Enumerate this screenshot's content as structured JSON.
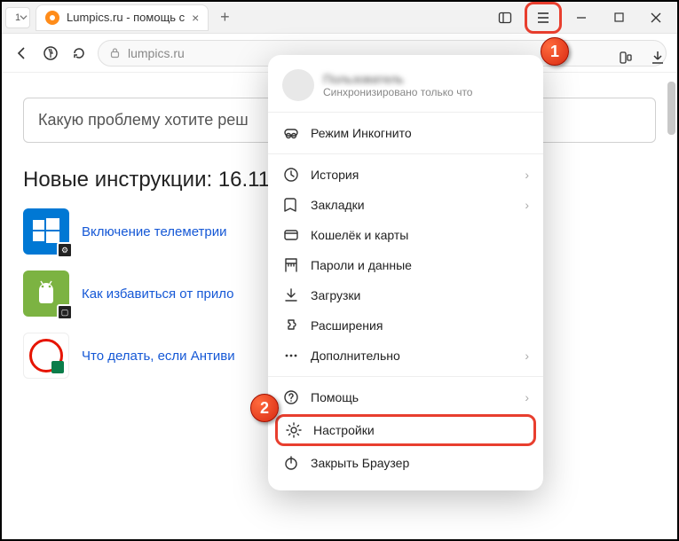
{
  "tab_bar": {
    "counter": "1",
    "tab_title": "Lumpics.ru - помощь с",
    "close": "×",
    "new_tab": "+"
  },
  "address": {
    "url": "lumpics.ru"
  },
  "page": {
    "search_placeholder": "Какую проблему хотите реш",
    "heading": "Новые инструкции: 16.11.",
    "articles": [
      {
        "text": "Включение телеметрии"
      },
      {
        "text": "Как избавиться от прило"
      },
      {
        "text": "Что делать, если Антиви"
      }
    ]
  },
  "menu": {
    "user": "Пользователь",
    "sync": "Синхронизировано только что",
    "items": [
      {
        "icon": "incognito",
        "label": "Режим Инкогнито",
        "arrow": false,
        "hl": false
      },
      {
        "sep": true
      },
      {
        "icon": "history",
        "label": "История",
        "arrow": true,
        "hl": false
      },
      {
        "icon": "bookmark",
        "label": "Закладки",
        "arrow": true,
        "hl": false
      },
      {
        "icon": "wallet",
        "label": "Кошелёк и карты",
        "arrow": false,
        "hl": false
      },
      {
        "icon": "key",
        "label": "Пароли и данные",
        "arrow": false,
        "hl": false
      },
      {
        "icon": "download",
        "label": "Загрузки",
        "arrow": false,
        "hl": false
      },
      {
        "icon": "puzzle",
        "label": "Расширения",
        "arrow": false,
        "hl": false
      },
      {
        "icon": "more",
        "label": "Дополнительно",
        "arrow": true,
        "hl": false
      },
      {
        "sep": true
      },
      {
        "icon": "help",
        "label": "Помощь",
        "arrow": true,
        "hl": false
      },
      {
        "icon": "settings",
        "label": "Настройки",
        "arrow": false,
        "hl": true
      },
      {
        "icon": "power",
        "label": "Закрыть Браузер",
        "arrow": false,
        "hl": false
      }
    ]
  },
  "badges": {
    "b1": "1",
    "b2": "2"
  }
}
